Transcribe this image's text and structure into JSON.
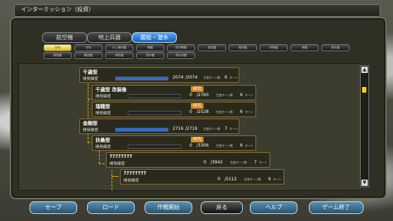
{
  "window": {
    "title": "インターミッション（投資）"
  },
  "categories": [
    {
      "label": "航空機",
      "active": false
    },
    {
      "label": "地上兵器",
      "active": false
    },
    {
      "label": "艦船・潜水",
      "active": true
    }
  ],
  "subtabs_row1": [
    "空母",
    "空母",
    "水上機母艦",
    "戦艦",
    "航空戦艦",
    "航巡艦",
    "駆逐艦",
    "特殊艦",
    "砲艦",
    "潜水艦"
  ],
  "subtabs_row2": [
    "揚陸艦",
    "輸送艦",
    "海防艦",
    "潜水艦",
    "潜水母艦"
  ],
  "labels": {
    "progress": "開発練度",
    "research": "研究",
    "turns_unit": "ターン",
    "turns_label": "生産ターン数"
  },
  "tree": [
    {
      "name": "千歳型",
      "value": "2074",
      "max": "/2074",
      "pct": 1.0,
      "turns": "6"
    },
    {
      "name": "千歳型 改装後",
      "value": "0",
      "max": "/2760",
      "pct": 0.0,
      "turns": "6",
      "research": true
    },
    {
      "name": "瑞穂型",
      "value": "0",
      "max": "/2528",
      "pct": 0.0,
      "turns": "6",
      "research": true
    },
    {
      "name": "金剛型",
      "value": "2716",
      "max": "/2716",
      "pct": 1.0,
      "turns": "7"
    },
    {
      "name": "扶桑型",
      "value": "0",
      "max": "/3306",
      "pct": 0.0,
      "turns": "6",
      "research": true
    },
    {
      "name": "????????",
      "value": "0",
      "max": "/3942",
      "pct": 0.0,
      "turns": "7"
    },
    {
      "name": "????????",
      "value": "0",
      "max": "/5112",
      "pct": 0.0,
      "turns": "9"
    }
  ],
  "scroll": {
    "up": "▲",
    "down": "▼"
  },
  "footer": {
    "save": "セーブ",
    "load": "ロード",
    "start": "作戦開始",
    "back": "戻る",
    "help": "ヘルプ",
    "quit": "ゲーム終了"
  }
}
